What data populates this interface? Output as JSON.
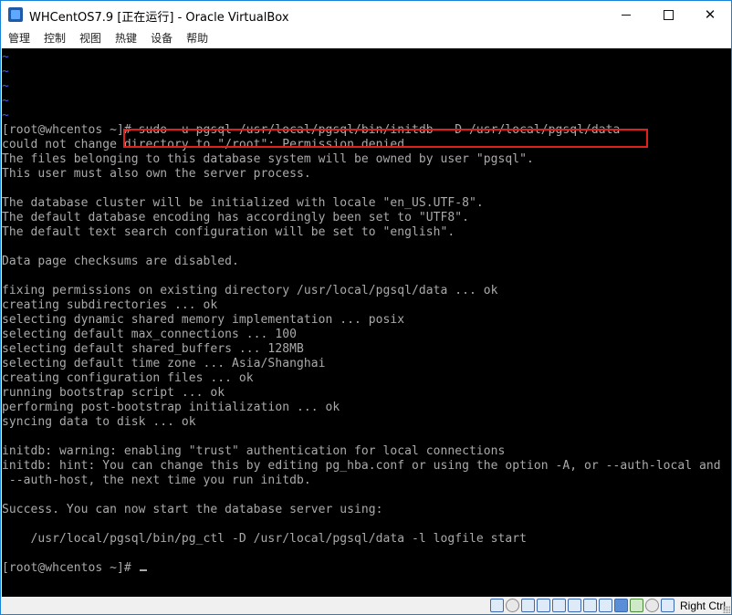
{
  "window": {
    "title": "WHCentOS7.9 [正在运行] - Oracle VirtualBox",
    "minimize_glyph": "",
    "close_glyph": "✕"
  },
  "menu": {
    "items": [
      "管理",
      "控制",
      "视图",
      "热键",
      "设备",
      "帮助"
    ]
  },
  "terminal": {
    "lines": [
      "~",
      "~",
      "~",
      "~",
      "~",
      "[root@whcentos ~]# sudo -u pgsql /usr/local/pgsql/bin/initdb  -D /usr/local/pgsql/data",
      "could not change directory to \"/root\": Permission denied",
      "The files belonging to this database system will be owned by user \"pgsql\".",
      "This user must also own the server process.",
      "",
      "The database cluster will be initialized with locale \"en_US.UTF-8\".",
      "The default database encoding has accordingly been set to \"UTF8\".",
      "The default text search configuration will be set to \"english\".",
      "",
      "Data page checksums are disabled.",
      "",
      "fixing permissions on existing directory /usr/local/pgsql/data ... ok",
      "creating subdirectories ... ok",
      "selecting dynamic shared memory implementation ... posix",
      "selecting default max_connections ... 100",
      "selecting default shared_buffers ... 128MB",
      "selecting default time zone ... Asia/Shanghai",
      "creating configuration files ... ok",
      "running bootstrap script ... ok",
      "performing post-bootstrap initialization ... ok",
      "syncing data to disk ... ok",
      "",
      "initdb: warning: enabling \"trust\" authentication for local connections",
      "initdb: hint: You can change this by editing pg_hba.conf or using the option -A, or --auth-local and",
      " --auth-host, the next time you run initdb.",
      "",
      "Success. You can now start the database server using:",
      "",
      "    /usr/local/pgsql/bin/pg_ctl -D /usr/local/pgsql/data -l logfile start",
      "",
      "[root@whcentos ~]# "
    ]
  },
  "statusbar": {
    "icons": [
      "hard-disk-icon",
      "optical-drive-icon",
      "audio-icon",
      "network-icon",
      "usb-icon",
      "shared-folder-icon",
      "display-icon",
      "video-capture-icon",
      "recording-icon",
      "cpu-icon",
      "mouse-integration-icon",
      "keyboard-icon"
    ],
    "host_key": "Right Ctrl"
  },
  "colors": {
    "terminal_bg": "#000000",
    "terminal_fg": "#aaaaaa",
    "tilde": "#4b5df0",
    "highlight_border": "#e0201a",
    "window_border": "#1883d7"
  }
}
